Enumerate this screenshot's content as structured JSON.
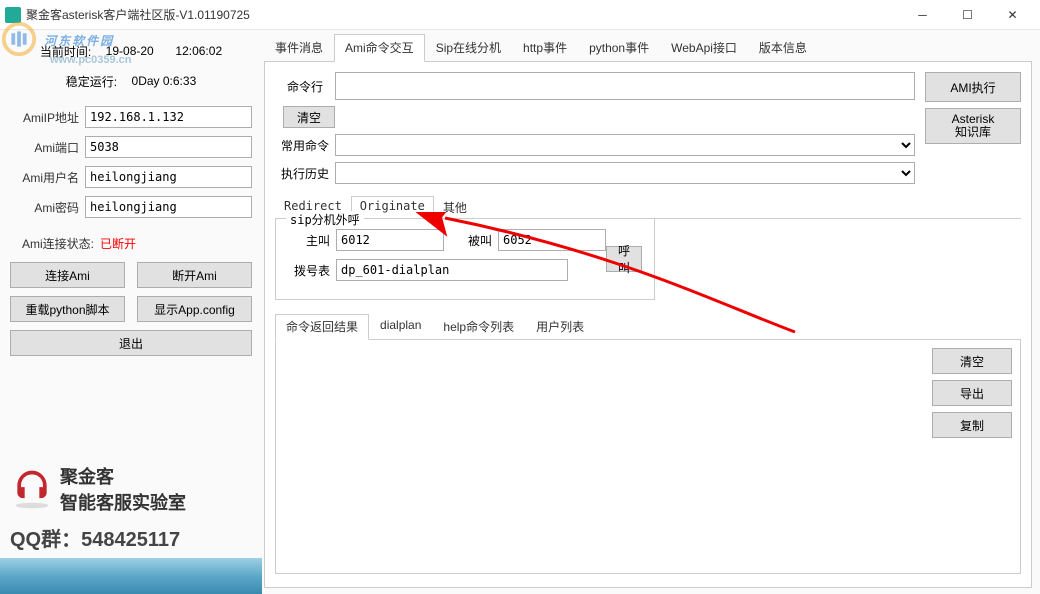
{
  "window": {
    "title": "聚金客asterisk客户端社区版-V1.01190725"
  },
  "left": {
    "time_label": "当前时间:",
    "time_value": "19-08-20",
    "time_clock": "12:06:02",
    "uptime_label": "稳定运行:",
    "uptime_value": "0Day 0:6:33",
    "ip_label": "AmiIP地址",
    "ip_value": "192.168.1.132",
    "port_label": "Ami端口",
    "port_value": "5038",
    "user_label": "Ami用户名",
    "user_value": "heilongjiang",
    "pass_label": "Ami密码",
    "pass_value": "heilongjiang",
    "conn_label": "Ami连接状态:",
    "conn_value": "已断开",
    "btn_connect": "连接Ami",
    "btn_disconnect": "断开Ami",
    "btn_reload_py": "重载python脚本",
    "btn_show_cfg": "显示App.config",
    "btn_exit": "退出"
  },
  "footer": {
    "brand1": "聚金客",
    "brand2": "智能客服实验室",
    "qq": "QQ群：548425117"
  },
  "tabs": {
    "t1": "事件消息",
    "t2": "Ami命令交互",
    "t3": "Sip在线分机",
    "t4": "http事件",
    "t5": "python事件",
    "t6": "WebApi接口",
    "t7": "版本信息"
  },
  "cmd": {
    "cmdline_label": "命令行",
    "clear": "清空",
    "common_label": "常用命令",
    "history_label": "执行历史",
    "ami_exec": "AMI执行",
    "kb1": "Asterisk",
    "kb2": "知识库"
  },
  "subtabs": {
    "s1": "Redirect",
    "s2": "Originate",
    "s3": "其他"
  },
  "orig": {
    "group": "sip分机外呼",
    "caller_label": "主叫",
    "caller_value": "6012",
    "callee_label": "被叫",
    "callee_value": "6052",
    "dial_label": "拨号表",
    "dial_value": "dp_601-dialplan",
    "call_btn": "呼叫"
  },
  "restabs": {
    "r1": "命令返回结果",
    "r2": "dialplan",
    "r3": "help命令列表",
    "r4": "用户列表",
    "clear": "清空",
    "export": "导出",
    "copy": "复制"
  },
  "watermark": {
    "text": "河东软件园",
    "url": "www.pc0359.cn"
  }
}
